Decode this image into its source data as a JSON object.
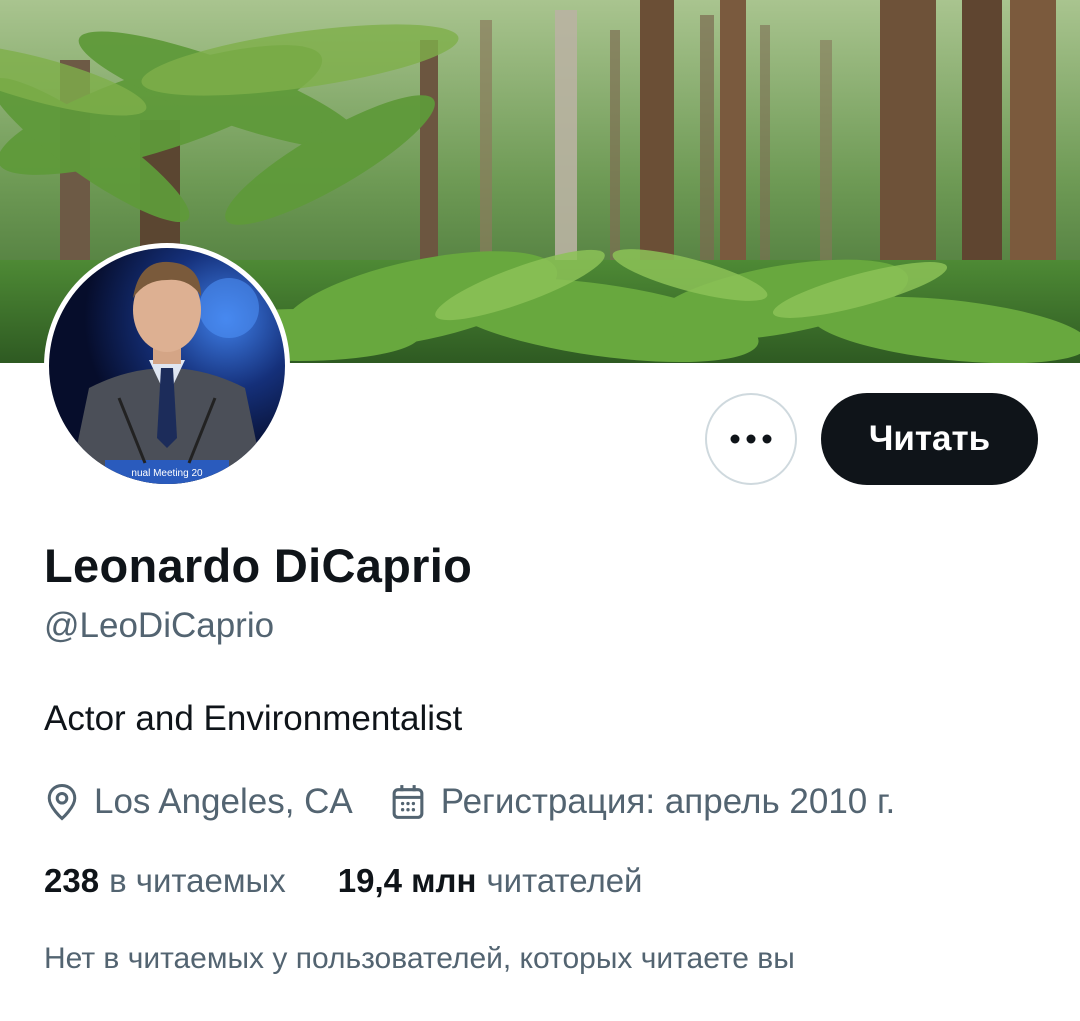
{
  "profile": {
    "display_name": "Leonardo DiCaprio",
    "handle": "@LeoDiCaprio",
    "bio": "Actor and Environmentalist",
    "location": "Los Angeles, CA",
    "joined": "Регистрация: апрель 2010 г.",
    "banner_description": "forest-banner",
    "avatar_description": "profile-photo"
  },
  "actions": {
    "more_icon": "more-horizontal-icon",
    "follow_label": "Читать"
  },
  "stats": {
    "following_count": "238",
    "following_label": "в читаемых",
    "followers_count": "19,4 млн",
    "followers_label": "читателей"
  },
  "note": {
    "followers_you_follow": "Нет в читаемых у пользователей, которых читаете вы"
  },
  "icons": {
    "location": "location-pin-icon",
    "calendar": "calendar-icon"
  },
  "colors": {
    "primary_text": "#0f1419",
    "secondary_text": "#536471",
    "button_dark": "#0f1419",
    "border": "#cfd9de"
  }
}
